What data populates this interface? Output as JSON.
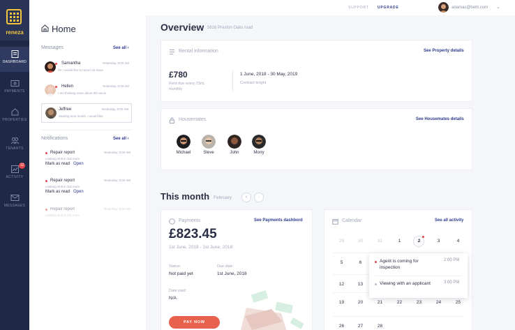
{
  "app": {
    "name": "reneza"
  },
  "nav": {
    "items": [
      {
        "label": "Dashboard",
        "icon": "dashboard-icon",
        "active": true
      },
      {
        "label": "Payments",
        "icon": "wallet-icon"
      },
      {
        "label": "Properties",
        "icon": "house-icon"
      },
      {
        "label": "Tenants",
        "icon": "people-icon"
      },
      {
        "label": "Activity",
        "icon": "chart-icon",
        "badge": "12"
      },
      {
        "label": "Messages",
        "icon": "mail-icon"
      }
    ]
  },
  "topbar": {
    "support": "SUPPORT",
    "upgrade": "UPGRADE",
    "email": "adamas@bettr.com"
  },
  "home": {
    "title": "Home",
    "messages_label": "Messages",
    "see_all": "See all",
    "messages": [
      {
        "name": "Samantha",
        "time": "Yesterday, 8:00 AM",
        "snippet": "Hi! I would like to report an issue",
        "unread": true
      },
      {
        "name": "Hellen",
        "time": "Yesterday, 8:00 AM",
        "snippet": "I am thinking more about 8th anniv",
        "unread": true
      },
      {
        "name": "Jeffree",
        "time": "Yesterday, 8:00 AM",
        "snippet": "Starting next month, I would like",
        "unread": false
      }
    ],
    "notifications_label": "Notifications",
    "notifications": [
      {
        "title": "Repair report",
        "time": "Yesterday, 8:00 AM",
        "desc": "Leaking sink in 3rd room",
        "mark": "Mark as read",
        "open": "Open"
      },
      {
        "title": "Repair report",
        "time": "Yesterday, 8:00 AM",
        "desc": "Leaking sink in 3rd room",
        "mark": "Mark as read",
        "open": "Open"
      },
      {
        "title": "Repair report",
        "time": "Yesterday, 8:00 AM",
        "desc": "Leaking sink in 3rd room",
        "mark": "",
        "open": ""
      }
    ]
  },
  "overview": {
    "title": "Overview",
    "address": "5616 Preston Oaks road",
    "rent": {
      "label": "Rental information",
      "link": "See Property details",
      "amount": "£780",
      "note": "Rent due every 23rd, monthly",
      "dates": "1 June, 2018 - 30 May, 2019",
      "dates_label": "Contract lenght"
    },
    "housemates": {
      "label": "Housemates",
      "link": "See Housemates details",
      "people": [
        "Michael",
        "Steve",
        "John",
        "Morry"
      ]
    }
  },
  "this_month": {
    "title": "This month",
    "month": "February",
    "payments": {
      "label": "Payments",
      "link": "See Payments dashbord",
      "amount": "£823.45",
      "range": "1st June, 2018 - 1st June, 2018",
      "status_label": "Status:",
      "status": "Not paid yet",
      "due_label": "Due date:",
      "due": "1st June, 2018",
      "paid_label": "Date paid:",
      "paid": "N/A",
      "button": "PAY NOW"
    },
    "calendar": {
      "label": "Calendar",
      "link": "See all activity",
      "rows": [
        [
          "29",
          "30",
          "31",
          "1",
          "2",
          "3",
          "4"
        ],
        [
          "5",
          "6",
          "7",
          "8",
          "9",
          "10",
          "11"
        ],
        [
          "12",
          "13",
          "14",
          "15",
          "16",
          "17",
          "18"
        ],
        [
          "19",
          "20",
          "21",
          "22",
          "23",
          "24",
          "25"
        ],
        [
          "26",
          "27",
          "28",
          "",
          "",
          "",
          ""
        ]
      ],
      "today": "2",
      "events": [
        {
          "title": "Agent is coming for inspection",
          "time": "2:00 PM",
          "color": "#e2464a"
        },
        {
          "title": "Viewing with an applicant",
          "time": "3:00 PM",
          "color": "#b9bed0"
        }
      ]
    }
  },
  "colors": {
    "rail": "#1f2845",
    "accent": "#2e3a8c",
    "logo": "#f3c53c",
    "danger": "#e2464a",
    "pay": "#e8614f"
  }
}
